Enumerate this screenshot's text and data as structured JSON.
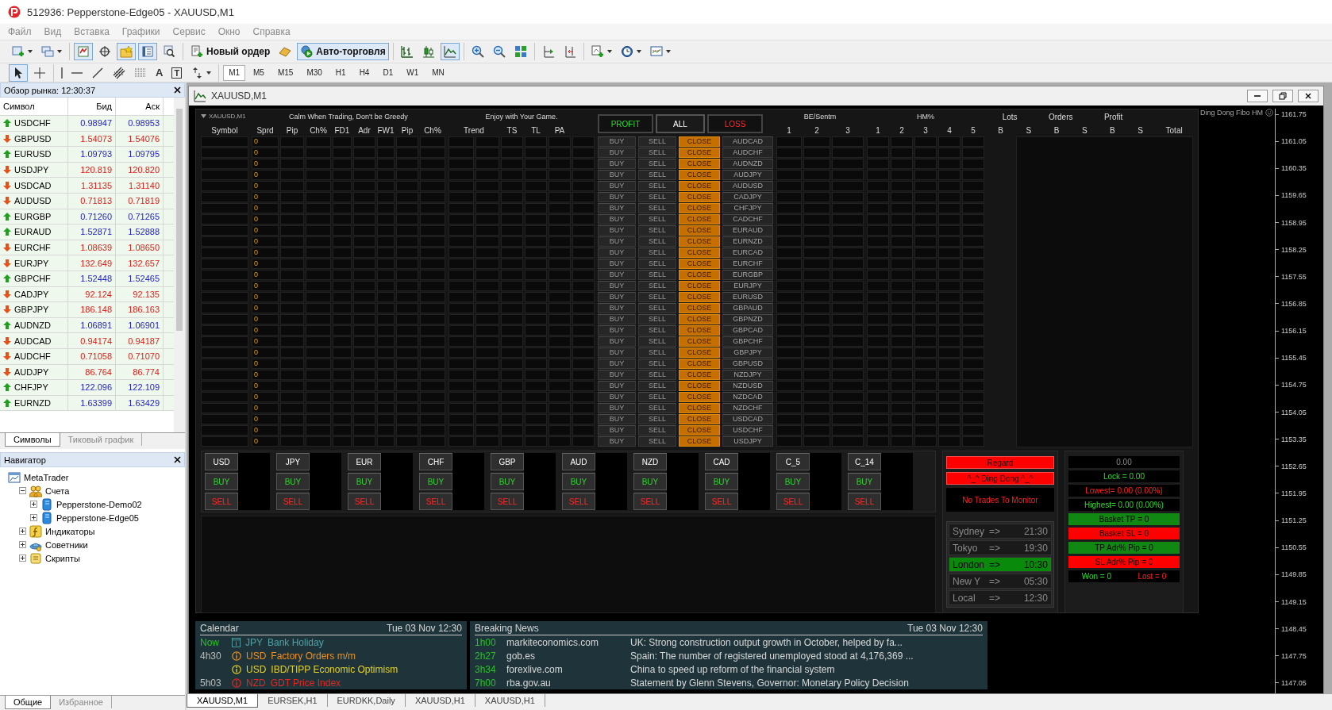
{
  "window": {
    "title": "512936: Pepperstone-Edge05 - XAUUSD,M1"
  },
  "menu": [
    "Файл",
    "Вид",
    "Вставка",
    "Графики",
    "Сервис",
    "Окно",
    "Справка"
  ],
  "toolbar": [
    [
      {
        "kind": "newchart",
        "selected": false
      },
      {
        "kind": "profiles",
        "selected": false
      }
    ],
    [
      {
        "kind": "marketwatch",
        "selected": true
      },
      {
        "kind": "datawindow",
        "selected": false
      },
      {
        "kind": "navigator",
        "selected": true
      },
      {
        "kind": "terminal",
        "selected": true
      },
      {
        "kind": "tester",
        "selected": false
      }
    ],
    [
      {
        "kind": "neworder",
        "label": "Новый ордер",
        "selected": false
      },
      {
        "kind": "metaeditor",
        "selected": false
      },
      {
        "kind": "autotrading",
        "label": "Авто-торговля",
        "selected": true
      }
    ],
    [
      {
        "kind": "bars",
        "selected": false
      },
      {
        "kind": "candles",
        "selected": false
      },
      {
        "kind": "line",
        "selected": true
      }
    ],
    [
      {
        "kind": "zoomin",
        "selected": false
      },
      {
        "kind": "zoomout",
        "selected": false
      },
      {
        "kind": "tile",
        "selected": false
      }
    ],
    [
      {
        "kind": "autoscroll",
        "selected": false
      },
      {
        "kind": "shift",
        "selected": false
      }
    ],
    [
      {
        "kind": "indicators",
        "selected": false
      },
      {
        "kind": "periods",
        "selected": false
      },
      {
        "kind": "templates",
        "selected": false
      }
    ]
  ],
  "drawing_toolbar": [
    [
      {
        "kind": "cursor",
        "selected": true
      },
      {
        "kind": "crosshair",
        "selected": false
      }
    ],
    [
      {
        "kind": "vline",
        "selected": false
      },
      {
        "kind": "hline",
        "selected": false
      },
      {
        "kind": "trendline",
        "selected": false
      },
      {
        "kind": "channel",
        "selected": false
      },
      {
        "kind": "fibo",
        "selected": false
      },
      {
        "kind": "text",
        "label": "A",
        "selected": false
      },
      {
        "kind": "textlabel",
        "label": "T",
        "selected": false
      },
      {
        "kind": "arrows",
        "selected": false
      }
    ]
  ],
  "timeframes": [
    {
      "label": "M1",
      "selected": true
    },
    {
      "label": "M5",
      "selected": false
    },
    {
      "label": "M15",
      "selected": false
    },
    {
      "label": "M30",
      "selected": false
    },
    {
      "label": "H1",
      "selected": false
    },
    {
      "label": "H4",
      "selected": false
    },
    {
      "label": "D1",
      "selected": false
    },
    {
      "label": "W1",
      "selected": false
    },
    {
      "label": "MN",
      "selected": false
    }
  ],
  "market_watch": {
    "title": "Обзор рынка: 12:30:37",
    "columns": [
      "Символ",
      "Бид",
      "Аск"
    ],
    "rows": [
      {
        "symbol": "USDCHF",
        "bid": "0.98947",
        "ask": "0.98953",
        "up": true
      },
      {
        "symbol": "GBPUSD",
        "bid": "1.54073",
        "ask": "1.54076",
        "up": false
      },
      {
        "symbol": "EURUSD",
        "bid": "1.09793",
        "ask": "1.09795",
        "up": true
      },
      {
        "symbol": "USDJPY",
        "bid": "120.819",
        "ask": "120.820",
        "up": false
      },
      {
        "symbol": "USDCAD",
        "bid": "1.31135",
        "ask": "1.31140",
        "up": false
      },
      {
        "symbol": "AUDUSD",
        "bid": "0.71813",
        "ask": "0.71819",
        "up": false
      },
      {
        "symbol": "EURGBP",
        "bid": "0.71260",
        "ask": "0.71265",
        "up": true
      },
      {
        "symbol": "EURAUD",
        "bid": "1.52871",
        "ask": "1.52888",
        "up": true
      },
      {
        "symbol": "EURCHF",
        "bid": "1.08639",
        "ask": "1.08650",
        "up": false
      },
      {
        "symbol": "EURJPY",
        "bid": "132.649",
        "ask": "132.657",
        "up": false
      },
      {
        "symbol": "GBPCHF",
        "bid": "1.52448",
        "ask": "1.52465",
        "up": true
      },
      {
        "symbol": "CADJPY",
        "bid": "92.124",
        "ask": "92.135",
        "up": false
      },
      {
        "symbol": "GBPJPY",
        "bid": "186.148",
        "ask": "186.163",
        "up": false
      },
      {
        "symbol": "AUDNZD",
        "bid": "1.06891",
        "ask": "1.06901",
        "up": true
      },
      {
        "symbol": "AUDCAD",
        "bid": "0.94174",
        "ask": "0.94187",
        "up": false
      },
      {
        "symbol": "AUDCHF",
        "bid": "0.71058",
        "ask": "0.71070",
        "up": false
      },
      {
        "symbol": "AUDJPY",
        "bid": "86.764",
        "ask": "86.774",
        "up": false
      },
      {
        "symbol": "CHFJPY",
        "bid": "122.096",
        "ask": "122.109",
        "up": true
      },
      {
        "symbol": "EURNZD",
        "bid": "1.63399",
        "ask": "1.63429",
        "up": true
      }
    ],
    "tabs": [
      {
        "label": "Символы",
        "selected": true
      },
      {
        "label": "Тиковый график",
        "selected": false
      }
    ]
  },
  "navigator": {
    "title": "Навигатор",
    "tree": [
      {
        "label": "MetaTrader",
        "kind": "root",
        "children": [
          {
            "label": "Счета",
            "kind": "accounts",
            "expanded": true,
            "children": [
              {
                "label": "Pepperstone-Demo02",
                "kind": "account",
                "expanded": false
              },
              {
                "label": "Pepperstone-Edge05",
                "kind": "account",
                "expanded": false
              }
            ]
          },
          {
            "label": "Индикаторы",
            "kind": "indicators",
            "expanded": false
          },
          {
            "label": "Советники",
            "kind": "experts",
            "expanded": false
          },
          {
            "label": "Скрипты",
            "kind": "scripts",
            "expanded": false
          }
        ]
      }
    ],
    "tabs": [
      {
        "label": "Общие",
        "selected": true
      },
      {
        "label": "Избранное",
        "selected": false
      }
    ]
  },
  "chart_window": {
    "title": "XAUUSD,M1",
    "prices": [
      "1161.75",
      "1161.05",
      "1160.35",
      "1159.65",
      "1158.95",
      "1158.25",
      "1157.55",
      "1156.85",
      "1156.15",
      "1155.45",
      "1154.75",
      "1154.05",
      "1153.35",
      "1152.65",
      "1151.95",
      "1151.25",
      "1150.55",
      "1149.85",
      "1149.15",
      "1148.45",
      "1147.75",
      "1147.05"
    ],
    "brand": "Ding Dong Fibo HM"
  },
  "dashboard": {
    "symbol_caption": "XAUUSD,M1",
    "symbol_header": "Symbol",
    "groups": [
      {
        "title": "Calm When Trading, Don't be Greedy",
        "columns": [
          "Sprd",
          "Pip",
          "Ch%",
          "FD1",
          "Adr",
          "FW1",
          "Pip",
          "Ch%"
        ]
      },
      {
        "title": "Enjoy with Your Game.",
        "columns": [
          "Trend",
          "TS",
          "TL",
          "PA"
        ]
      }
    ],
    "filters": [
      {
        "label": "PROFIT",
        "kind": "profit"
      },
      {
        "label": "ALL",
        "kind": "all"
      },
      {
        "label": "LOSS",
        "kind": "loss"
      }
    ],
    "be": {
      "title": "BE/Sentm",
      "columns": [
        "1",
        "2",
        "3"
      ]
    },
    "hm": {
      "title": "HM%",
      "columns": [
        "1",
        "2",
        "3",
        "4",
        "5"
      ]
    },
    "totals": {
      "titles": [
        "Lots",
        "Orders",
        "Profit"
      ],
      "columns": [
        "B",
        "S",
        "B",
        "S",
        "B",
        "S",
        "Total"
      ]
    },
    "rows": [
      {
        "sprd": "0",
        "buy": "BUY",
        "sell": "SELL",
        "close": "CLOSE",
        "pair": "AUDCAD"
      },
      {
        "sprd": "0",
        "buy": "BUY",
        "sell": "SELL",
        "close": "CLOSE",
        "pair": "AUDCHF"
      },
      {
        "sprd": "0",
        "buy": "BUY",
        "sell": "SELL",
        "close": "CLOSE",
        "pair": "AUDNZD"
      },
      {
        "sprd": "0",
        "buy": "BUY",
        "sell": "SELL",
        "close": "CLOSE",
        "pair": "AUDJPY"
      },
      {
        "sprd": "0",
        "buy": "BUY",
        "sell": "SELL",
        "close": "CLOSE",
        "pair": "AUDUSD"
      },
      {
        "sprd": "0",
        "buy": "BUY",
        "sell": "SELL",
        "close": "CLOSE",
        "pair": "CADJPY"
      },
      {
        "sprd": "0",
        "buy": "BUY",
        "sell": "SELL",
        "close": "CLOSE",
        "pair": "CHFJPY"
      },
      {
        "sprd": "0",
        "buy": "BUY",
        "sell": "SELL",
        "close": "CLOSE",
        "pair": "CADCHF"
      },
      {
        "sprd": "0",
        "buy": "BUY",
        "sell": "SELL",
        "close": "CLOSE",
        "pair": "EURAUD"
      },
      {
        "sprd": "0",
        "buy": "BUY",
        "sell": "SELL",
        "close": "CLOSE",
        "pair": "EURNZD"
      },
      {
        "sprd": "0",
        "buy": "BUY",
        "sell": "SELL",
        "close": "CLOSE",
        "pair": "EURCAD"
      },
      {
        "sprd": "0",
        "buy": "BUY",
        "sell": "SELL",
        "close": "CLOSE",
        "pair": "EURCHF"
      },
      {
        "sprd": "0",
        "buy": "BUY",
        "sell": "SELL",
        "close": "CLOSE",
        "pair": "EURGBP"
      },
      {
        "sprd": "0",
        "buy": "BUY",
        "sell": "SELL",
        "close": "CLOSE",
        "pair": "EURJPY"
      },
      {
        "sprd": "0",
        "buy": "BUY",
        "sell": "SELL",
        "close": "CLOSE",
        "pair": "EURUSD"
      },
      {
        "sprd": "0",
        "buy": "BUY",
        "sell": "SELL",
        "close": "CLOSE",
        "pair": "GBPAUD"
      },
      {
        "sprd": "0",
        "buy": "BUY",
        "sell": "SELL",
        "close": "CLOSE",
        "pair": "GBPNZD"
      },
      {
        "sprd": "0",
        "buy": "BUY",
        "sell": "SELL",
        "close": "CLOSE",
        "pair": "GBPCAD"
      },
      {
        "sprd": "0",
        "buy": "BUY",
        "sell": "SELL",
        "close": "CLOSE",
        "pair": "GBPCHF"
      },
      {
        "sprd": "0",
        "buy": "BUY",
        "sell": "SELL",
        "close": "CLOSE",
        "pair": "GBPJPY"
      },
      {
        "sprd": "0",
        "buy": "BUY",
        "sell": "SELL",
        "close": "CLOSE",
        "pair": "GBPUSD"
      },
      {
        "sprd": "0",
        "buy": "BUY",
        "sell": "SELL",
        "close": "CLOSE",
        "pair": "NZDJPY"
      },
      {
        "sprd": "0",
        "buy": "BUY",
        "sell": "SELL",
        "close": "CLOSE",
        "pair": "NZDUSD"
      },
      {
        "sprd": "0",
        "buy": "BUY",
        "sell": "SELL",
        "close": "CLOSE",
        "pair": "NZDCAD"
      },
      {
        "sprd": "0",
        "buy": "BUY",
        "sell": "SELL",
        "close": "CLOSE",
        "pair": "NZDCHF"
      },
      {
        "sprd": "0",
        "buy": "BUY",
        "sell": "SELL",
        "close": "CLOSE",
        "pair": "USDCAD"
      },
      {
        "sprd": "0",
        "buy": "BUY",
        "sell": "SELL",
        "close": "CLOSE",
        "pair": "USDCHF"
      },
      {
        "sprd": "0",
        "buy": "BUY",
        "sell": "SELL",
        "close": "CLOSE",
        "pair": "USDJPY"
      }
    ],
    "currencies": [
      {
        "name": "USD",
        "buy": "BUY",
        "sell": "SELL"
      },
      {
        "name": "JPY",
        "buy": "BUY",
        "sell": "SELL"
      },
      {
        "name": "EUR",
        "buy": "BUY",
        "sell": "SELL"
      },
      {
        "name": "CHF",
        "buy": "BUY",
        "sell": "SELL"
      },
      {
        "name": "GBP",
        "buy": "BUY",
        "sell": "SELL"
      },
      {
        "name": "AUD",
        "buy": "BUY",
        "sell": "SELL"
      },
      {
        "name": "NZD",
        "buy": "BUY",
        "sell": "SELL"
      },
      {
        "name": "CAD",
        "buy": "BUY",
        "sell": "SELL"
      },
      {
        "name": "C_5",
        "buy": "BUY",
        "sell": "SELL"
      },
      {
        "name": "C_14",
        "buy": "BUY",
        "sell": "SELL"
      }
    ],
    "alerts": {
      "buttons": [
        "Regard",
        "^_^ Ding Dong ^_^"
      ],
      "status": "No Trades To Monitor"
    },
    "sessions": [
      {
        "city": "Sydney",
        "arrow": "=>",
        "time": "21:30",
        "active": false
      },
      {
        "city": "Tokyo",
        "arrow": "=>",
        "time": "19:30",
        "active": false
      },
      {
        "city": "London",
        "arrow": "=>",
        "time": "10:30",
        "active": true
      },
      {
        "city": "New Y",
        "arrow": "=>",
        "time": "05:30",
        "active": false
      },
      {
        "city": "Local",
        "arrow": "=>",
        "time": "12:30",
        "active": false
      }
    ],
    "stats": [
      {
        "text": "0.00",
        "kind": "neutral",
        "filled": false
      },
      {
        "text": "Lock = 0.00",
        "kind": "positive",
        "filled": false
      },
      {
        "text": "Lowest= 0.00 (0.00%)",
        "kind": "negative",
        "filled": false
      },
      {
        "text": "Highest= 0.00 (0.00%)",
        "kind": "positive",
        "filled": false
      },
      {
        "text": "Basket TP = 0",
        "kind": "positive",
        "filled": true
      },
      {
        "text": "Basket SL = 0",
        "kind": "negative",
        "filled": true
      },
      {
        "text": "TP Adr% Pip = 0",
        "kind": "positive",
        "filled": true
      },
      {
        "text": "SL Adr% Pip = 0",
        "kind": "negative",
        "filled": true
      }
    ],
    "results": [
      {
        "text": "Won =  0",
        "kind": "positive"
      },
      {
        "text": "Lost =  0",
        "kind": "negative"
      }
    ]
  },
  "calendar": {
    "title": "Calendar",
    "date": "Tue 03 Nov 12:30",
    "events": [
      {
        "time": "Now",
        "current": true,
        "kind": "holiday",
        "color": "#4fa3a8",
        "currency": "JPY",
        "title": "Bank Holiday"
      },
      {
        "time": "4h30",
        "current": false,
        "kind": "event",
        "color": "#f0901e",
        "currency": "USD",
        "title": "Factory Orders m/m"
      },
      {
        "kind": "event",
        "color": "#e6d21e",
        "currency": "USD",
        "title": "IBD/TIPP Economic Optimism"
      },
      {
        "time": "5h03",
        "current": false,
        "kind": "event",
        "color": "#e8261e",
        "currency": "NZD",
        "title": "GDT Price Index"
      }
    ]
  },
  "news": {
    "title": "Breaking News",
    "date": "Tue 03 Nov 12:30",
    "items": [
      {
        "age": "1h00",
        "source": "markiteconomics.com",
        "headline": "UK: Strong construction output growth in October, helped by fa..."
      },
      {
        "age": "2h27",
        "source": "gob.es",
        "headline": "Spain: The number of registered unemployed stood at 4,176,369 ..."
      },
      {
        "age": "3h34",
        "source": "forexlive.com",
        "headline": "China to speed up reform of the financial system"
      },
      {
        "age": "7h00",
        "source": "rba.gov.au",
        "headline": "Statement by Glenn Stevens, Governor: Monetary Policy Decision"
      }
    ]
  },
  "chart_tabs": [
    {
      "label": "XAUUSD,M1",
      "selected": true
    },
    {
      "label": "EURSEK,H1",
      "selected": false
    },
    {
      "label": "EURDKK,Daily",
      "selected": false
    },
    {
      "label": "XAUUSD,H1",
      "selected": false
    },
    {
      "label": "XAUUSD,H1",
      "selected": false
    }
  ]
}
